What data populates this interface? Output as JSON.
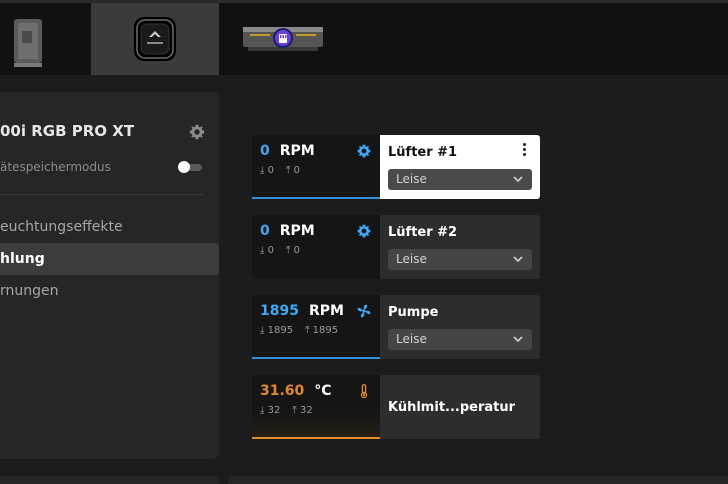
{
  "app": {
    "accent": "#3fa9f5",
    "temp_accent": "#e08a2c"
  },
  "devices": [
    {
      "name": "memory-module-device",
      "icon": "ram-stick-icon"
    },
    {
      "name": "aio-cooler-device",
      "icon": "corsair-pump-head-icon",
      "active": true
    },
    {
      "name": "rgb-ram-device",
      "icon": "rgb-ram-icon"
    }
  ],
  "sidebar": {
    "device_title": "00i RGB PRO XT",
    "hardware_mode_label": "ätespeichermodus",
    "nav": [
      {
        "label": "euchtungseffekte"
      },
      {
        "label": "hlung",
        "active": true
      },
      {
        "label": "rnungen"
      }
    ]
  },
  "cards": [
    {
      "value": "0",
      "unit": "RPM",
      "min": "0",
      "max": "0",
      "icon": "fan-gear-icon",
      "name": "Lüfter #1",
      "preset": "Leise",
      "selected": true
    },
    {
      "value": "0",
      "unit": "RPM",
      "min": "0",
      "max": "0",
      "icon": "fan-gear-icon",
      "name": "Lüfter #2",
      "preset": "Leise"
    },
    {
      "value": "1895",
      "unit": "RPM",
      "min": "1895",
      "max": "1895",
      "icon": "pump-fan-icon",
      "name": "Pumpe",
      "preset": "Leise"
    },
    {
      "value": "31.60",
      "unit": "°C",
      "min": "32",
      "max": "32",
      "icon": "thermometer-icon",
      "name": "Kühlmit...peratur",
      "temp": true
    }
  ]
}
